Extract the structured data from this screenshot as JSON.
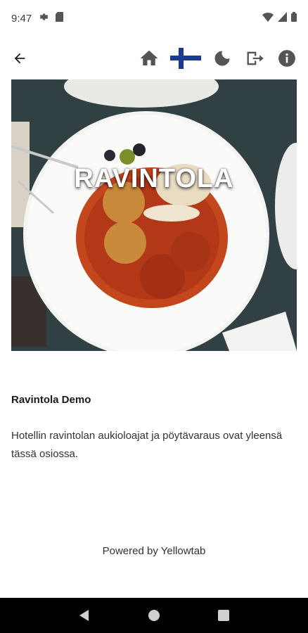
{
  "status_bar": {
    "time": "9:47",
    "icons_left": [
      "gear-icon",
      "sim-card-icon"
    ],
    "icons_right": [
      "wifi-icon",
      "cell-signal-icon",
      "battery-icon"
    ]
  },
  "toolbar": {
    "back_icon": "arrow-left-icon",
    "actions": [
      "home-icon",
      "finland-flag-icon",
      "moon-icon",
      "logout-icon",
      "info-icon"
    ]
  },
  "hero": {
    "title": "RAVINTOLA"
  },
  "content": {
    "title": "Ravintola Demo",
    "description": "Hotellin ravintolan aukioloajat ja pöytävaraus ovat yleensä tässä osiossa."
  },
  "footer": {
    "powered_by": "Powered by Yellowtab"
  },
  "colors": {
    "icon": "#555555",
    "flag_blue": "#1a3a8f"
  }
}
